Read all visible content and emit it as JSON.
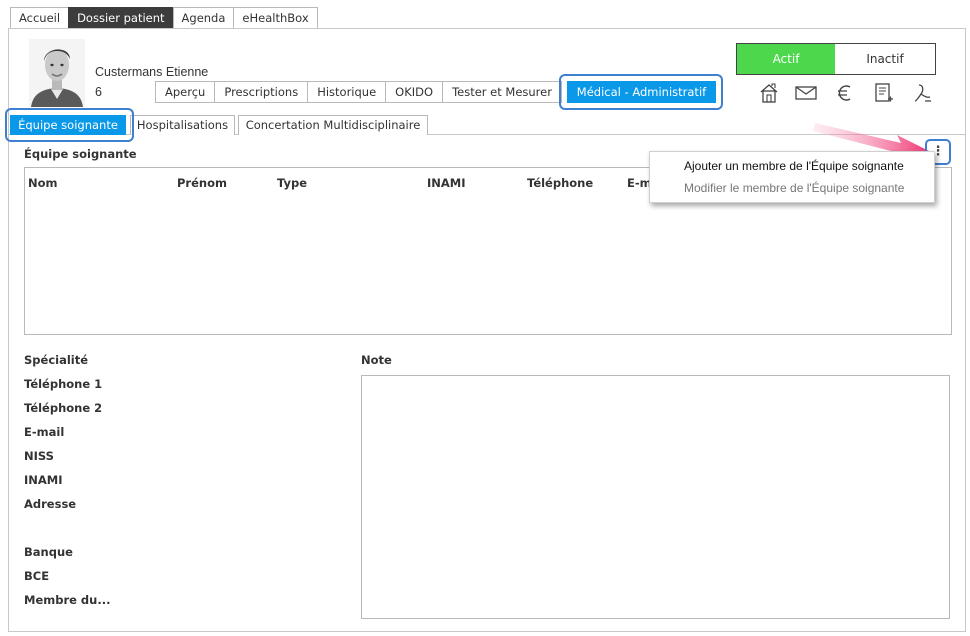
{
  "top_nav": {
    "tabs": [
      {
        "label": "Accueil"
      },
      {
        "label": "Dossier patient",
        "active": true
      },
      {
        "label": "Agenda"
      },
      {
        "label": "eHealthBox"
      }
    ]
  },
  "patient": {
    "name": "Custermans Etienne",
    "number": "6"
  },
  "patient_tabs": [
    {
      "label": "Aperçu"
    },
    {
      "label": "Prescriptions"
    },
    {
      "label": "Historique"
    },
    {
      "label": "OKIDO"
    },
    {
      "label": "Tester et Mesurer"
    },
    {
      "label": "Médical - Administratif",
      "active": true
    }
  ],
  "status": {
    "active_label": "Actif",
    "inactive_label": "Inactif",
    "active_color": "#4cd74c"
  },
  "toolbar_icons": [
    "home-dossier-icon",
    "mail-icon",
    "euro-icon",
    "document-add-icon",
    "person-signature-icon"
  ],
  "section_tabs": [
    {
      "label": "Équipe soignante",
      "active": true
    },
    {
      "label": "Hospitalisations"
    },
    {
      "label": "Concertation Multidisciplinaire"
    }
  ],
  "section_title": "Équipe soignante",
  "grid": {
    "columns": [
      "Nom",
      "Prénom",
      "Type",
      "INAMI",
      "Téléphone",
      "E-m"
    ]
  },
  "context_menu": {
    "items": [
      {
        "label": "Ajouter un membre de l'Équipe soignante",
        "enabled": true
      },
      {
        "label": "Modifier le membre de l'Équipe soignante",
        "enabled": false
      }
    ]
  },
  "detail_labels": [
    "Spécialité",
    "Téléphone 1",
    "Téléphone 2",
    "E-mail",
    "NISS",
    "INAMI",
    "Adresse",
    "Banque",
    "BCE",
    "Membre du..."
  ],
  "note_label": "Note",
  "colors": {
    "accent_blue": "#0a98e8",
    "highlight_outline": "#3f7fcf",
    "arrow_pink": "#ee2f6e",
    "nav_dark": "#3c3c3c"
  }
}
